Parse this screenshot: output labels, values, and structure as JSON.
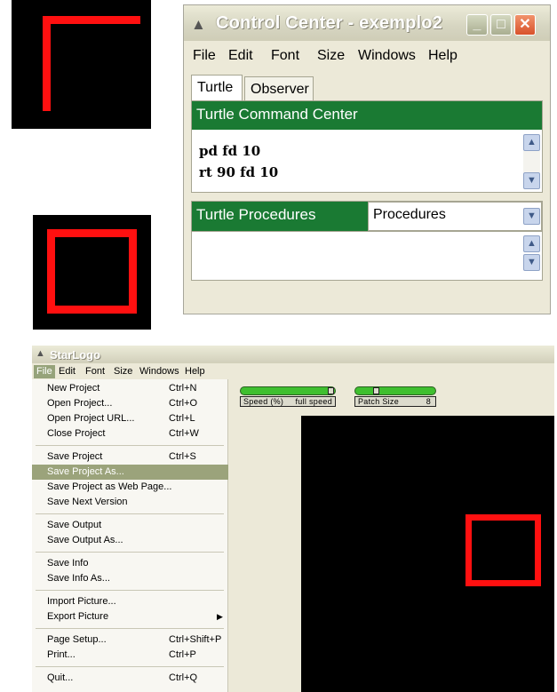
{
  "control_center": {
    "title": "Control Center - exemplo2",
    "menu": [
      "File",
      "Edit",
      "Font",
      "Size",
      "Windows",
      "Help"
    ],
    "tabs": [
      "Turtle",
      "Observer"
    ],
    "command_center": {
      "header": "Turtle Command Center",
      "lines": [
        "pd fd 10",
        "rt 90 fd 10"
      ]
    },
    "procedures": {
      "header": "Turtle Procedures",
      "dropdown_value": "Procedures"
    }
  },
  "starlogo": {
    "title": "StarLogo",
    "menu": [
      "File",
      "Edit",
      "Font",
      "Size",
      "Windows",
      "Help"
    ],
    "file_menu": {
      "groups": [
        [
          {
            "label": "New Project",
            "shortcut": "Ctrl+N"
          },
          {
            "label": "Open Project...",
            "shortcut": "Ctrl+O"
          },
          {
            "label": "Open Project URL...",
            "shortcut": "Ctrl+L"
          },
          {
            "label": "Close Project",
            "shortcut": "Ctrl+W"
          }
        ],
        [
          {
            "label": "Save Project",
            "shortcut": "Ctrl+S"
          },
          {
            "label": "Save Project As...",
            "shortcut": "",
            "highlighted": true
          },
          {
            "label": "Save Project as Web Page...",
            "shortcut": ""
          },
          {
            "label": "Save Next Version",
            "shortcut": ""
          }
        ],
        [
          {
            "label": "Save Output",
            "shortcut": ""
          },
          {
            "label": "Save Output As...",
            "shortcut": ""
          }
        ],
        [
          {
            "label": "Save Info",
            "shortcut": ""
          },
          {
            "label": "Save Info As...",
            "shortcut": ""
          }
        ],
        [
          {
            "label": "Import Picture...",
            "shortcut": ""
          },
          {
            "label": "Export Picture",
            "shortcut": "",
            "submenu": true
          }
        ],
        [
          {
            "label": "Page Setup...",
            "shortcut": "Ctrl+Shift+P"
          },
          {
            "label": "Print...",
            "shortcut": "Ctrl+P"
          }
        ],
        [
          {
            "label": "Quit...",
            "shortcut": "Ctrl+Q"
          }
        ]
      ]
    },
    "sliders": [
      {
        "name": "Speed (%)",
        "value": "full speed",
        "level": 0.96
      },
      {
        "name": "Patch Size",
        "value": "8",
        "level": 0.25
      }
    ]
  },
  "colors": {
    "accent_green": "#1a7a33",
    "drawing_red": "#ff1010",
    "menu_highlight": "#9ba37b"
  }
}
